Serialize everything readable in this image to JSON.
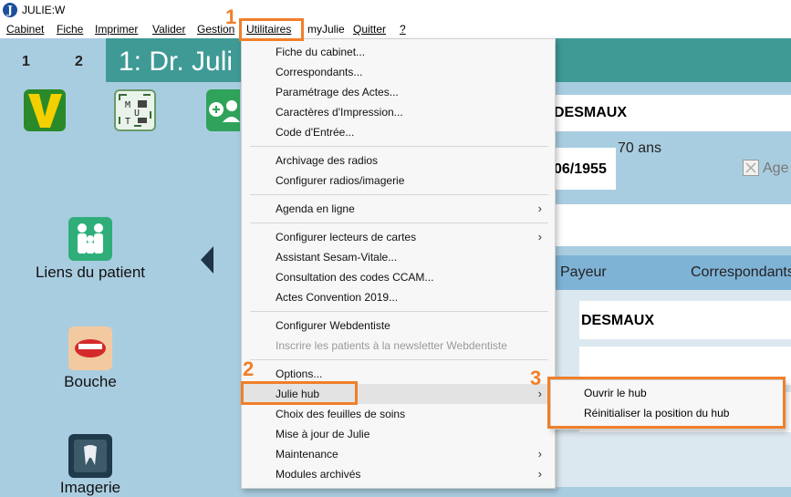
{
  "window": {
    "title": "JULIE:W",
    "app_icon": "J"
  },
  "menubar": [
    "Cabinet",
    "Fiche",
    "Imprimer",
    "Valider",
    "Gestion",
    "Utilitaires",
    "myJulie",
    "Quitter",
    "?"
  ],
  "tabs": [
    "1",
    "2"
  ],
  "header": {
    "title": "1: Dr. Juli"
  },
  "left_icons": [
    {
      "label": "Liens du patient",
      "icon": "family-icon"
    },
    {
      "label": "Bouche",
      "icon": "mouth-icon"
    },
    {
      "label": "Imagerie",
      "icon": "xray-icon"
    }
  ],
  "patient": {
    "name": "DESMAUX",
    "dob": "06/1955",
    "age": "70 ans",
    "age_checkbox_label": "Age",
    "tabs": [
      "Payeur",
      "Correspondants"
    ],
    "payer_name": "DESMAUX"
  },
  "utilitaires_menu": {
    "items": [
      {
        "label": "Fiche du cabinet..."
      },
      {
        "label": "Correspondants..."
      },
      {
        "label": "Paramétrage des Actes..."
      },
      {
        "label": "Caractères d'Impression..."
      },
      {
        "label": "Code d'Entrée..."
      },
      {
        "label": "Archivage des radios"
      },
      {
        "label": "Configurer radios/imagerie"
      },
      {
        "label": "Agenda en ligne"
      },
      {
        "label": "Configurer lecteurs de cartes"
      },
      {
        "label": "Assistant Sesam-Vitale..."
      },
      {
        "label": "Consultation des codes CCAM..."
      },
      {
        "label": "Actes Convention 2019..."
      },
      {
        "label": "Configurer Webdentiste"
      },
      {
        "label": "Inscrire les patients à la newsletter Webdentiste"
      },
      {
        "label": "Options..."
      },
      {
        "label": "Julie hub"
      },
      {
        "label": "Choix des feuilles de soins"
      },
      {
        "label": "Mise à jour de Julie"
      },
      {
        "label": "Maintenance"
      },
      {
        "label": "Modules archivés"
      }
    ],
    "submenu_arrow": "›"
  },
  "julie_hub_submenu": [
    "Ouvrir le hub",
    "Réinitialiser la position du hub"
  ],
  "callouts": [
    "1",
    "2",
    "3"
  ],
  "colors": {
    "accent": "#f07f2a",
    "header": "#3f9a96",
    "sidebar": "#a9cde0"
  }
}
